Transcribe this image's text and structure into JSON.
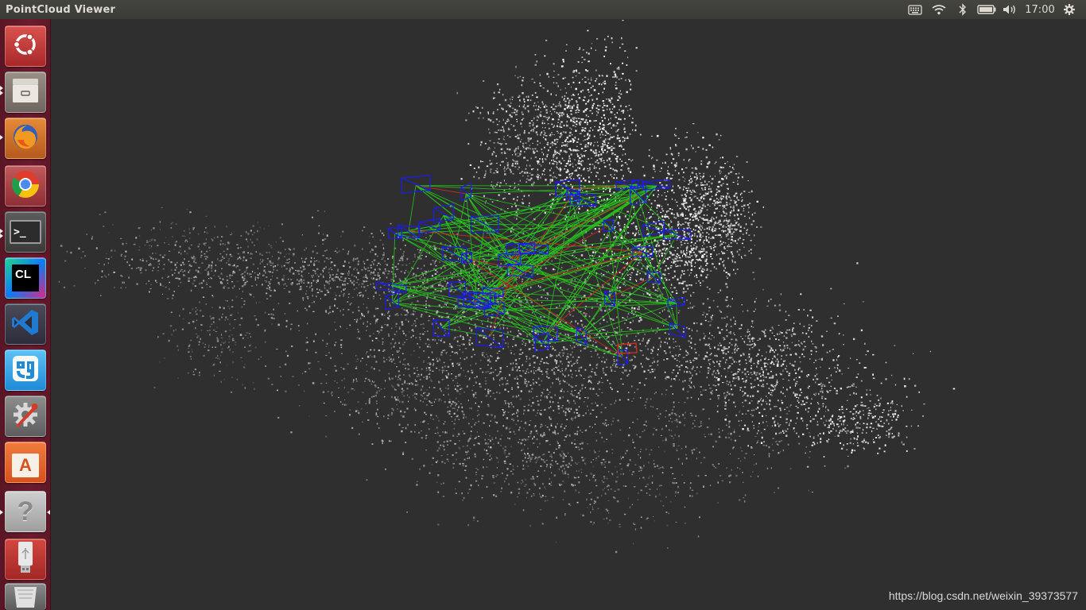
{
  "window": {
    "title": "PointCloud Viewer"
  },
  "panel": {
    "indicators": [
      "keyboard-icon",
      "wifi-icon",
      "bluetooth-icon",
      "battery-icon",
      "volume-icon",
      "power-gear-icon"
    ],
    "clock": "17:00"
  },
  "launcher": {
    "items": [
      {
        "name": "ubuntu-dash",
        "icon": "ubuntu-logo-icon"
      },
      {
        "name": "files",
        "icon": "file-cabinet-icon"
      },
      {
        "name": "firefox",
        "icon": "firefox-icon"
      },
      {
        "name": "chrome",
        "icon": "chrome-icon"
      },
      {
        "name": "terminal",
        "icon": "terminal-icon",
        "glyph": ">_"
      },
      {
        "name": "clion",
        "icon": "clion-icon",
        "glyph": "CL"
      },
      {
        "name": "vscode",
        "icon": "vscode-icon"
      },
      {
        "name": "qq",
        "icon": "qq-icon"
      },
      {
        "name": "system-settings",
        "icon": "wrench-gear-icon"
      },
      {
        "name": "software-center",
        "icon": "shopping-bag-icon",
        "glyph": "A"
      },
      {
        "name": "help",
        "icon": "help-icon",
        "glyph": "?"
      },
      {
        "name": "usb-drive",
        "icon": "usb-drive-icon"
      },
      {
        "name": "trash",
        "icon": "trash-icon"
      }
    ],
    "colors": {
      "background": "#6d1b2e"
    }
  },
  "viewer": {
    "background": "#2f2f2f",
    "keyframe_color": "#1a1aff",
    "covisibility_color": "#27c41a",
    "loop_color": "#d42b1f",
    "watermark": "https://blog.csdn.net/weixin_39373577"
  }
}
